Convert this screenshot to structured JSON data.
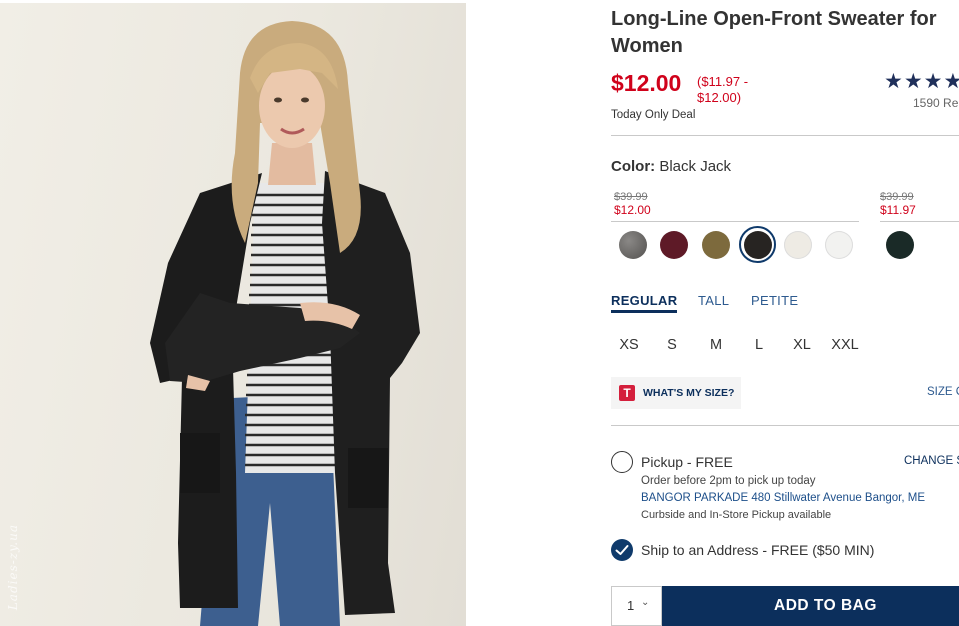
{
  "product": {
    "title": "Long-Line Open-Front Sweater for Women",
    "price": "$12.00",
    "price_range": "($11.97 - $12.00)",
    "deal": "Today Only Deal",
    "rating_stars": "★★★★",
    "review_count": "1590 Re"
  },
  "photo": {
    "watermark": "Ladies-zy.ua"
  },
  "color": {
    "label": "Color:",
    "selected": "Black Jack",
    "group1": {
      "original": "$39.99",
      "sale": "$12.00"
    },
    "group2": {
      "original": "$39.99",
      "sale": "$11.97"
    },
    "swatches": [
      {
        "name": "heather-gray",
        "hex": "#6f6d6b"
      },
      {
        "name": "burgundy",
        "hex": "#5e1a27"
      },
      {
        "name": "olive",
        "hex": "#7d6a3d"
      },
      {
        "name": "black-jack",
        "hex": "#272422",
        "selected": true
      },
      {
        "name": "cream",
        "hex": "#eeebe4"
      },
      {
        "name": "white",
        "hex": "#f2f2f0"
      },
      {
        "name": "dark-green",
        "hex": "#1a2a27"
      }
    ]
  },
  "fit_tabs": [
    "REGULAR",
    "TALL",
    "PETITE"
  ],
  "sizes": [
    "XS",
    "S",
    "M",
    "L",
    "XL",
    "XXL"
  ],
  "fit_helper": {
    "logo": "T",
    "label": "WHAT'S MY SIZE?",
    "size_chart": "SIZE C"
  },
  "pickup": {
    "label": "Pickup - FREE",
    "change": "CHANGE S",
    "note": "Order before 2pm to pick up today",
    "store": "BANGOR PARKADE 480 Stillwater Avenue  Bangor, ME",
    "curbside": "Curbside and In-Store Pickup available"
  },
  "ship": {
    "label": "Ship to an Address - FREE ($50 MIN)"
  },
  "cart": {
    "quantity": "1",
    "quantity_chevron": "⌄",
    "add_label": "ADD TO BAG"
  }
}
